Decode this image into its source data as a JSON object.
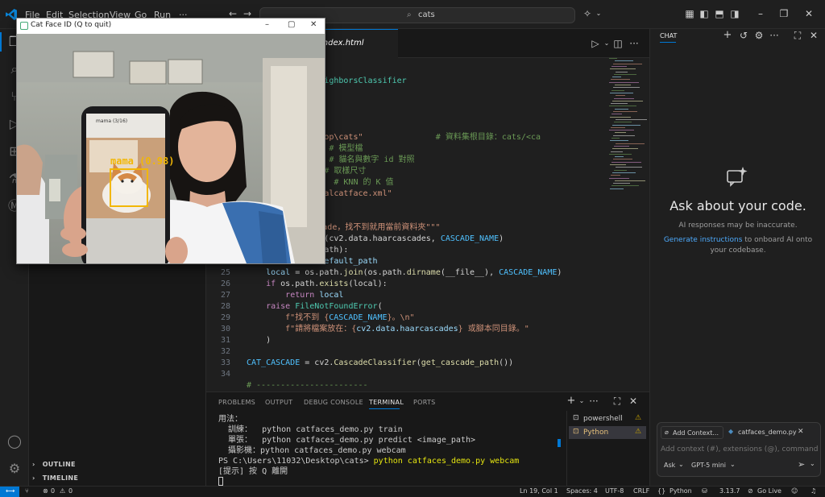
{
  "titlebar": {
    "menus": [
      "File",
      "Edit",
      "Selection",
      "View",
      "Go",
      "Run",
      "···"
    ],
    "search_placeholder": "cats"
  },
  "editor": {
    "tab_label": "index.html",
    "code_lines": [
      {
        "n": "",
        "segments": [
          {
            "t": "p",
            "c": "plain"
          }
        ]
      },
      {
        "n": "",
        "segments": [
          {
            "t": "nbors ",
            "c": "plain"
          },
          {
            "t": "import",
            "c": "kw"
          },
          {
            "t": " KNeighborsClassifier",
            "c": "cls"
          }
        ]
      },
      {
        "n": "",
        "segments": []
      },
      {
        "n": "",
        "segments": [
          {
            "t": "---------",
            "c": "cm"
          }
        ]
      },
      {
        "n": "",
        "segments": [
          {
            "t": "本)",
            "c": "cm"
          }
        ]
      },
      {
        "n": "",
        "segments": [
          {
            "t": "---------",
            "c": "cm"
          }
        ]
      },
      {
        "n": "",
        "segments": [
          {
            "t": "sers\\11032\\Desktop\\cats\"",
            "c": "str"
          },
          {
            "t": "               # 資料集根目錄：cats/<ca",
            "c": "cm"
          }
        ]
      },
      {
        "n": "",
        "segments": [
          {
            "t": "_knn.pkl\"",
            "c": "str"
          },
          {
            "t": "        # 模型檔",
            "c": "cm"
          }
        ]
      },
      {
        "n": "",
        "segments": [
          {
            "t": "bels.json\"",
            "c": "str"
          },
          {
            "t": "       # 貓名與數字 id 對照",
            "c": "cm"
          }
        ]
      },
      {
        "n": "",
        "segments": [
          {
            "t": " 128)",
            "c": "num"
          },
          {
            "t": "           # 取樣尺寸",
            "c": "cm"
          }
        ]
      },
      {
        "n": "",
        "segments": [
          {
            "t": "                  # KNN 的 K 值",
            "c": "cm"
          }
        ]
      },
      {
        "n": "",
        "segments": [
          {
            "t": "aarcascade_frontalcatface.xml\"",
            "c": "str"
          }
        ]
      },
      {
        "n": "",
        "segments": []
      },
      {
        "n": "",
        "segments": [
          {
            "t": "path",
            "c": "fn"
          },
          {
            "t": "():",
            "c": "plain"
          }
        ]
      },
      {
        "n": "",
        "segments": [
          {
            "t": "到 cat face cascade，找不到就用當前資料夾\"\"\"",
            "c": "str"
          }
        ]
      },
      {
        "n": "",
        "segments": [
          {
            "t": "h = os.path.",
            "c": "plain"
          },
          {
            "t": "join",
            "c": "fn"
          },
          {
            "t": "(cv2.data.haarcascades, ",
            "c": "plain"
          },
          {
            "t": "CASCADE_NAME",
            "c": "cst"
          },
          {
            "t": ")",
            "c": "plain"
          }
        ]
      },
      {
        "n": "",
        "segments": [
          {
            "t": "exists",
            "c": "fn"
          },
          {
            "t": "(default_path):",
            "c": "plain"
          }
        ]
      },
      {
        "n": "24",
        "segments": [
          {
            "t": "        ",
            "c": "plain"
          },
          {
            "t": "return",
            "c": "kw"
          },
          {
            "t": " default_path",
            "c": "var"
          }
        ]
      },
      {
        "n": "25",
        "segments": [
          {
            "t": "    local",
            "c": "var"
          },
          {
            "t": " = os.path.",
            "c": "plain"
          },
          {
            "t": "join",
            "c": "fn"
          },
          {
            "t": "(os.path.",
            "c": "plain"
          },
          {
            "t": "dirname",
            "c": "fn"
          },
          {
            "t": "(__file__), ",
            "c": "plain"
          },
          {
            "t": "CASCADE_NAME",
            "c": "cst"
          },
          {
            "t": ")",
            "c": "plain"
          }
        ]
      },
      {
        "n": "26",
        "segments": [
          {
            "t": "    ",
            "c": "plain"
          },
          {
            "t": "if",
            "c": "kw"
          },
          {
            "t": " os.path.",
            "c": "plain"
          },
          {
            "t": "exists",
            "c": "fn"
          },
          {
            "t": "(local):",
            "c": "plain"
          }
        ]
      },
      {
        "n": "27",
        "segments": [
          {
            "t": "        ",
            "c": "plain"
          },
          {
            "t": "return",
            "c": "kw"
          },
          {
            "t": " local",
            "c": "var"
          }
        ]
      },
      {
        "n": "28",
        "segments": [
          {
            "t": "    ",
            "c": "plain"
          },
          {
            "t": "raise",
            "c": "kw"
          },
          {
            "t": " FileNotFoundError",
            "c": "cls"
          },
          {
            "t": "(",
            "c": "plain"
          }
        ]
      },
      {
        "n": "29",
        "segments": [
          {
            "t": "        f\"找不到 {",
            "c": "str"
          },
          {
            "t": "CASCADE_NAME",
            "c": "cst"
          },
          {
            "t": "}。\\n\"",
            "c": "str"
          }
        ]
      },
      {
        "n": "30",
        "segments": [
          {
            "t": "        f\"請將檔案放在：{",
            "c": "str"
          },
          {
            "t": "cv2.data.haarcascades",
            "c": "var"
          },
          {
            "t": "} 或腳本同目錄。\"",
            "c": "str"
          }
        ]
      },
      {
        "n": "31",
        "segments": [
          {
            "t": "    )",
            "c": "plain"
          }
        ]
      },
      {
        "n": "32",
        "segments": []
      },
      {
        "n": "33",
        "segments": [
          {
            "t": "CAT_CASCADE",
            "c": "cst"
          },
          {
            "t": " = cv2.",
            "c": "plain"
          },
          {
            "t": "CascadeClassifier",
            "c": "fn"
          },
          {
            "t": "(",
            "c": "plain"
          },
          {
            "t": "get_cascade_path",
            "c": "fn"
          },
          {
            "t": "())",
            "c": "plain"
          }
        ]
      },
      {
        "n": "34",
        "segments": []
      },
      {
        "n": "",
        "segments": [
          {
            "t": "# -----------------------",
            "c": "cm"
          }
        ]
      }
    ]
  },
  "panel": {
    "tabs": [
      "PROBLEMS",
      "OUTPUT",
      "DEBUG CONSOLE",
      "TERMINAL",
      "PORTS"
    ],
    "active_tab": "TERMINAL",
    "terminal_lines": [
      "用法：",
      "  訓練：  python catfaces_demo.py train",
      "  單張：  python catfaces_demo.py predict <image_path>",
      "  攝影機：python catfaces_demo.py webcam",
      "PS C:\\Users\\11032\\Desktop\\cats> python catfaces_demo.py webcam",
      "[提示] 按 Q 離開"
    ],
    "terminal_prompt": "PS C:\\Users\\11032\\Desktop\\cats> ",
    "terminal_command": "python catfaces_demo.py webcam",
    "terminals": [
      "powershell",
      "Python"
    ]
  },
  "sidebar": {
    "sections": [
      "OUTLINE",
      "TIMELINE"
    ]
  },
  "chat": {
    "header": "CHAT",
    "title": "Ask about your code.",
    "disclaimer": "AI responses may be inaccurate.",
    "link_text": "Generate instructions",
    "body_text": " to onboard AI onto your codebase.",
    "add_context": "Add Context...",
    "file_chip": "catfaces_demo.py",
    "input_placeholder": "Add context (#), extensions (@), commands",
    "mode": "Ask",
    "model": "GPT-5 mini"
  },
  "statusbar": {
    "errors": "0",
    "warnings": "0",
    "position": "Ln 19, Col 1",
    "spaces": "Spaces: 4",
    "encoding": "UTF-8",
    "eol": "CRLF",
    "language": "Python",
    "python_version": "3.13.7",
    "golive": "Go Live"
  },
  "camera": {
    "title": "Cat Face ID (Q to quit)",
    "detection_label": "mama (0.98)",
    "phone_title": "mama (3/16)"
  },
  "colors": {
    "accent": "#0078d4",
    "detect": "#f2b705",
    "link": "#4daafc"
  }
}
